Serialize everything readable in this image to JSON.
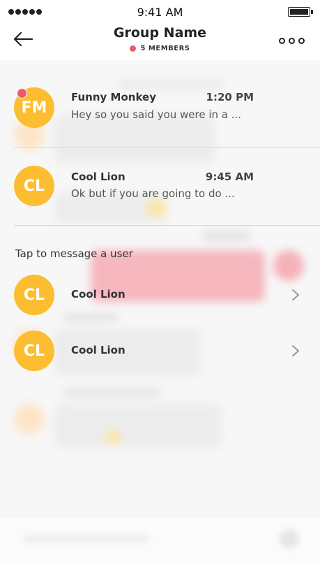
{
  "status_bar": {
    "time": "9:41 AM"
  },
  "header": {
    "title": "Group Name",
    "members": "5 MEMBERS",
    "member_dot_color": "#ef5a6a"
  },
  "conversations": [
    {
      "initials": "FM",
      "name": "Funny Monkey",
      "time": "1:20 PM",
      "preview": "Hey so you said you were in a ...",
      "unread": true
    },
    {
      "initials": "CL",
      "name": "Cool Lion",
      "time": "9:45 AM",
      "preview": "Ok but if you are going to do ...",
      "unread": false
    }
  ],
  "tap_section": {
    "label": "Tap to message a user",
    "users": [
      {
        "initials": "CL",
        "name": "Cool Lion"
      },
      {
        "initials": "CL",
        "name": "Cool Lion"
      }
    ]
  },
  "colors": {
    "avatar": "#fcbd30",
    "accent": "#ef5a6a"
  }
}
